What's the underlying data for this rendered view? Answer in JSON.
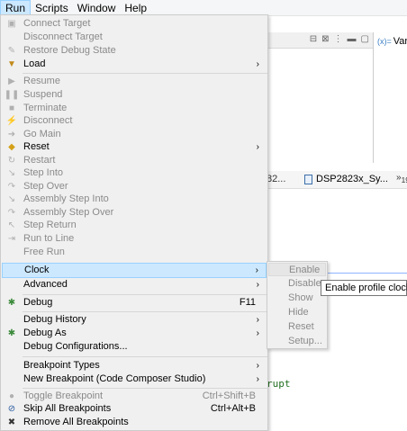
{
  "menubar": [
    "Run",
    "Scripts",
    "Window",
    "Help"
  ],
  "menu_items": [
    {
      "label": "Connect Target",
      "icon": "connect-icon",
      "disabled": true
    },
    {
      "label": "Disconnect Target",
      "icon": "",
      "disabled": true
    },
    {
      "label": "Restore Debug State",
      "icon": "restore-icon",
      "disabled": true
    },
    {
      "label": "Load",
      "icon": "load-icon",
      "disabled": false,
      "submenu": true
    },
    {
      "label": "Resume",
      "icon": "resume-icon",
      "disabled": true
    },
    {
      "label": "Suspend",
      "icon": "suspend-icon",
      "disabled": true
    },
    {
      "label": "Terminate",
      "icon": "terminate-icon",
      "disabled": true
    },
    {
      "label": "Disconnect",
      "icon": "disconnect-icon",
      "disabled": true
    },
    {
      "label": "Go Main",
      "icon": "go-main-icon",
      "disabled": true
    },
    {
      "label": "Reset",
      "icon": "reset-icon",
      "disabled": false,
      "submenu": true
    },
    {
      "label": "Restart",
      "icon": "restart-icon",
      "disabled": true
    },
    {
      "label": "Step Into",
      "icon": "step-into-icon",
      "disabled": true
    },
    {
      "label": "Step Over",
      "icon": "step-over-icon",
      "disabled": true
    },
    {
      "label": "Assembly Step Into",
      "icon": "asm-step-into-icon",
      "disabled": true
    },
    {
      "label": "Assembly Step Over",
      "icon": "asm-step-over-icon",
      "disabled": true
    },
    {
      "label": "Step Return",
      "icon": "step-return-icon",
      "disabled": true
    },
    {
      "label": "Run to Line",
      "icon": "run-to-line-icon",
      "disabled": true
    },
    {
      "label": "Free Run",
      "icon": "",
      "disabled": true
    },
    {
      "label": "Clock",
      "icon": "",
      "disabled": false,
      "submenu": true,
      "highlighted": true
    },
    {
      "label": "Advanced",
      "icon": "",
      "disabled": false,
      "submenu": true
    },
    {
      "label": "Debug",
      "icon": "debug-icon",
      "disabled": false,
      "shortcut": "F11"
    },
    {
      "label": "Debug History",
      "icon": "",
      "disabled": false,
      "submenu": true
    },
    {
      "label": "Debug As",
      "icon": "debug-as-icon",
      "disabled": false,
      "submenu": true
    },
    {
      "label": "Debug Configurations...",
      "icon": "",
      "disabled": false
    },
    {
      "label": "Breakpoint Types",
      "icon": "",
      "disabled": false,
      "submenu": true
    },
    {
      "label": "New Breakpoint (Code Composer Studio)",
      "icon": "",
      "disabled": false,
      "submenu": true
    },
    {
      "label": "Toggle Breakpoint",
      "icon": "toggle-breakpoint-icon",
      "disabled": true,
      "shortcut": "Ctrl+Shift+B"
    },
    {
      "label": "Skip All Breakpoints",
      "icon": "skip-breakpoints-icon",
      "disabled": false,
      "shortcut": "Ctrl+Alt+B"
    },
    {
      "label": "Remove All Breakpoints",
      "icon": "remove-breakpoints-icon",
      "disabled": false
    }
  ],
  "clock_submenu": [
    {
      "label": "Enable",
      "highlighted": true
    },
    {
      "label": "Disable"
    },
    {
      "label": "Show"
    },
    {
      "label": "Hide"
    },
    {
      "label": "Reset"
    },
    {
      "label": "Setup..."
    }
  ],
  "tooltip": "Enable profile clock",
  "background": {
    "var_tab": "Vari",
    "editor_tab_partial": "82...",
    "editor_tab": "DSP2823x_Sy...",
    "overflow_count": "19",
    "code_fragment": "rupt"
  },
  "colors": {
    "menu_bg": "#f0f0f0",
    "highlight": "#cce8ff",
    "highlight_border": "#99d1ff",
    "disabled_text": "#8a8a8a"
  }
}
